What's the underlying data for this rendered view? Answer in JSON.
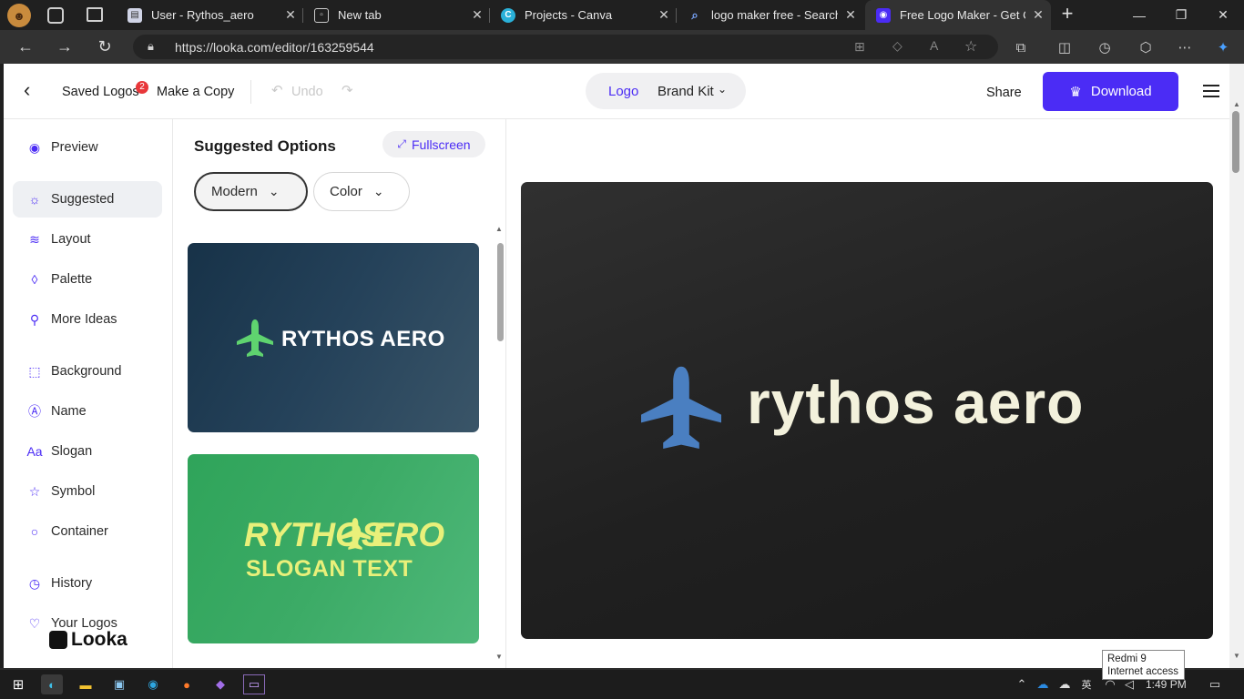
{
  "browser": {
    "tabs": [
      {
        "title": "User - Rythos_aero",
        "active": false
      },
      {
        "title": "New tab",
        "active": false
      },
      {
        "title": "Projects - Canva",
        "active": false
      },
      {
        "title": "logo maker free - Search",
        "active": false
      },
      {
        "title": "Free Logo Maker - Get Cus",
        "active": true
      }
    ],
    "url": "https://looka.com/editor/163259544"
  },
  "header": {
    "saved_logos": "Saved Logos",
    "saved_badge": "2",
    "make_copy": "Make a Copy",
    "undo": "Undo",
    "mode_logo": "Logo",
    "mode_brandkit": "Brand Kit",
    "share": "Share",
    "download": "Download"
  },
  "sidebar": {
    "items": [
      {
        "label": "Preview",
        "icon": "eye-icon"
      },
      {
        "label": "Suggested",
        "icon": "lightbulb-icon",
        "selected": true
      },
      {
        "label": "Layout",
        "icon": "layers-icon"
      },
      {
        "label": "Palette",
        "icon": "droplet-icon"
      },
      {
        "label": "More Ideas",
        "icon": "magic-wand-icon"
      },
      {
        "label": "Background",
        "icon": "background-icon"
      },
      {
        "label": "Name",
        "icon": "name-icon"
      },
      {
        "label": "Slogan",
        "icon": "slogan-icon"
      },
      {
        "label": "Symbol",
        "icon": "star-icon"
      },
      {
        "label": "Container",
        "icon": "circle-icon"
      },
      {
        "label": "History",
        "icon": "history-icon"
      },
      {
        "label": "Your Logos",
        "icon": "heart-icon"
      }
    ],
    "brand": "Looka"
  },
  "options": {
    "title": "Suggested Options",
    "fullscreen": "Fullscreen",
    "filter_style": "Modern",
    "filter_color": "Color",
    "cards": [
      {
        "name_text": "RYTHOS AERO",
        "bg": "#1c3a4f",
        "fg": "#ffffff",
        "icon_color": "#5fd36f"
      },
      {
        "name_text_left": "RYTHOS",
        "name_text_right": "ERO",
        "slogan": "SLOGAN TEXT",
        "bg": "#3aa864",
        "fg": "#e9f07a"
      }
    ]
  },
  "preview": {
    "logo_text": "rythos aero",
    "text_color": "#f3f1dc",
    "symbol_color": "#4a7fc1"
  },
  "taskbar": {
    "time": "1:49 PM",
    "tooltip_line1": "Redmi 9",
    "tooltip_line2": "Internet access"
  }
}
